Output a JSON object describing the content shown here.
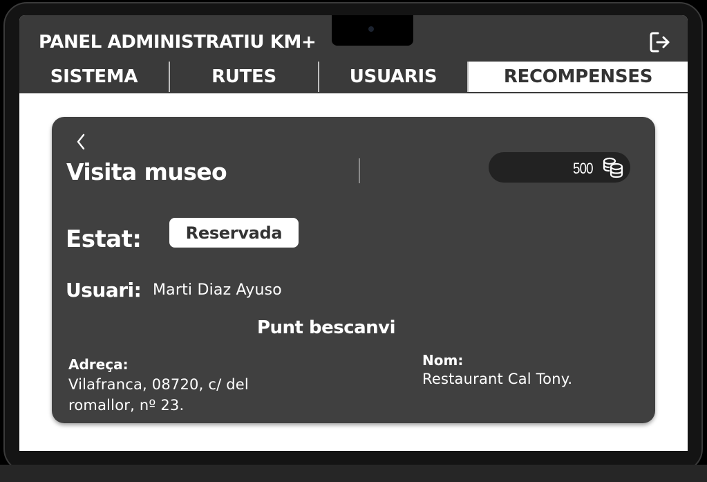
{
  "header": {
    "title": "PANEL ADMINISTRATIU KM+",
    "logout_icon": "logout-icon"
  },
  "tabs": [
    {
      "label": "SISTEMA",
      "active": false
    },
    {
      "label": "RUTES",
      "active": false
    },
    {
      "label": "USUARIS",
      "active": false
    },
    {
      "label": "RECOMPENSES",
      "active": true
    }
  ],
  "reward": {
    "back_icon": "chevron-left-icon",
    "title": "Visita museo",
    "points": "500",
    "points_icon": "coins-icon",
    "status_label": "Estat:",
    "status_value": "Reservada",
    "user_label": "Usuari:",
    "user_value": "Marti Diaz Ayuso",
    "redeem_point": {
      "heading": "Punt bescanvi",
      "address_label": "Adreça:",
      "address_value": "Vilafranca, 08720, c/ del\nromallor,  nº 23.",
      "name_label": "Nom:",
      "name_value": "Restaurant Cal Tony."
    }
  },
  "colors": {
    "header_bg": "#3a3a3a",
    "card_bg": "#404040",
    "points_pill_bg": "#222222",
    "active_tab_bg": "#ffffff"
  }
}
